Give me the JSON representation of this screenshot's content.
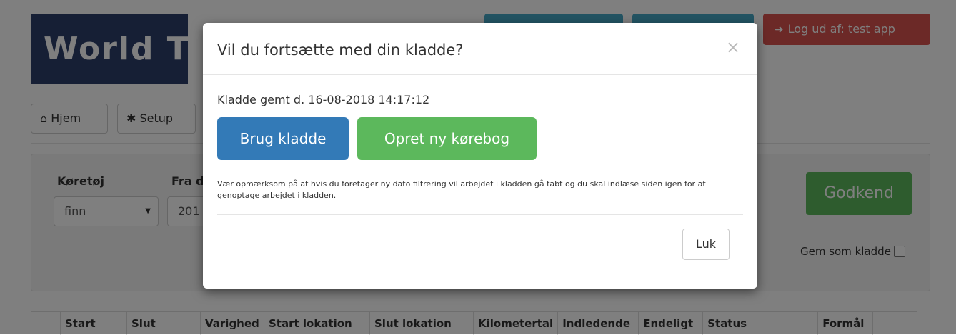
{
  "header": {
    "logo_text": "World T",
    "logout_label": "Log ud af: test app"
  },
  "nav": {
    "home_label": "Hjem",
    "setup_label": "Setup"
  },
  "filter": {
    "vehicle_label": "Køretøj",
    "vehicle_value": "finn",
    "from_label": "Fra d",
    "from_value": "201",
    "approve_label": "Godkend",
    "save_draft_label": "Gem som kladde"
  },
  "table": {
    "columns": [
      "",
      "Start",
      "Slut",
      "Varighed",
      "Start lokation",
      "Slut lokation",
      "Kilometertal",
      "Indledende",
      "Endeligt",
      "Status",
      "Formål",
      ""
    ]
  },
  "modal": {
    "title": "Vil du fortsætte med din kladde?",
    "close_glyph": "×",
    "saved_text": "Kladde gemt d. 16-08-2018 14:17:12",
    "use_draft_label": "Brug kladde",
    "new_log_label": "Opret ny kørebog",
    "warning_text": "Vær opmærksom på at hvis du foretager ny dato filtrering vil arbejdet i kladden gå tabt og du skal indlæse siden igen for at genoptage arbejdet i kladden.",
    "close_label": "Luk"
  },
  "colors": {
    "primary": "#337ab7",
    "success": "#5cb85c",
    "danger": "#d9534f",
    "info": "#46a9c6",
    "logo_bg": "#2c3e6b"
  }
}
